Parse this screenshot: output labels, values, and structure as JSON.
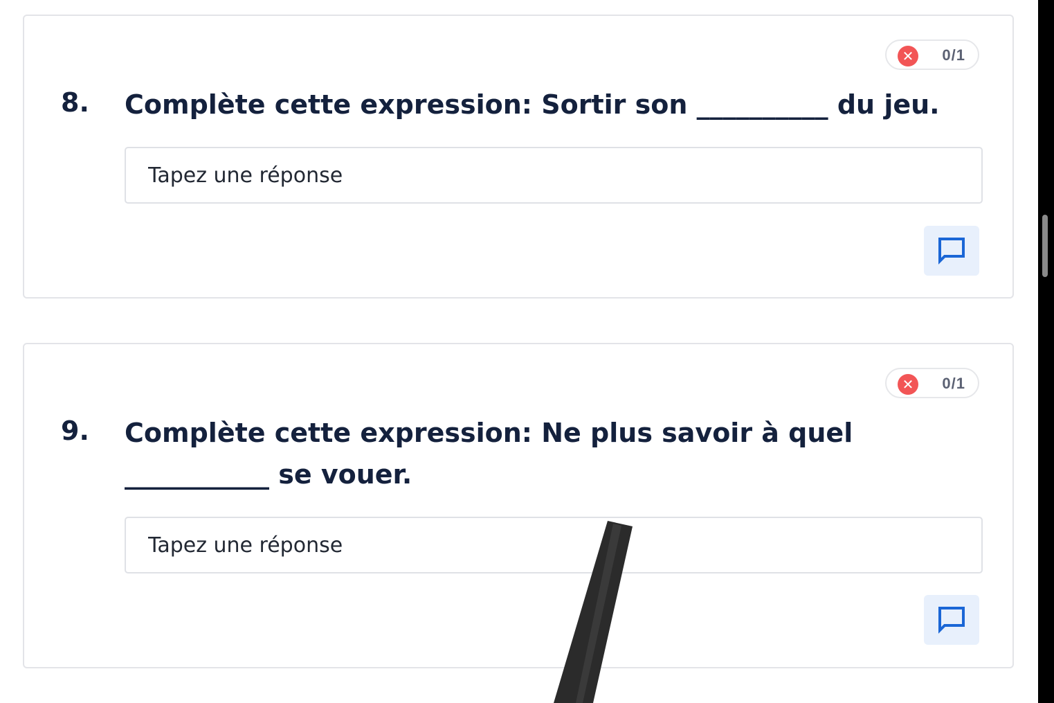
{
  "questions": [
    {
      "number": "8.",
      "text": "Complète cette expression: Sortir son __________ du jeu.",
      "score": "0/1",
      "status_icon": "x-icon",
      "status_color": "#f25556",
      "answer_placeholder": "Tapez une réponse",
      "comment_icon": "comment-icon"
    },
    {
      "number": "9.",
      "text": "Complète cette expression: Ne plus savoir à quel ___________ se vouer.",
      "score": "0/1",
      "status_icon": "x-icon",
      "status_color": "#f25556",
      "answer_placeholder": "Tapez une réponse",
      "comment_icon": "comment-icon"
    }
  ],
  "colors": {
    "heading": "#14213d",
    "accent": "#1a66d6",
    "comment_bg": "#e8f0fc",
    "card_border": "#e3e4e8"
  },
  "glyphs": {
    "x_mark": "✕"
  }
}
